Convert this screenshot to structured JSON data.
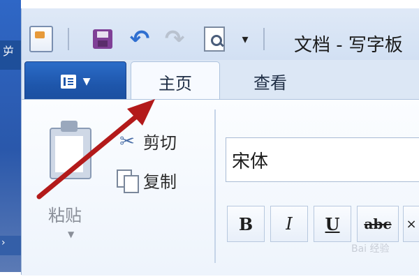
{
  "colors": {
    "ribbon_blue": "#1e56ab",
    "accent_undo": "#2f6fd0",
    "annotation_red": "#b31a1a"
  },
  "window": {
    "title": "文档 - 写字板"
  },
  "quick_access": {
    "icons": [
      "document-icon",
      "save-icon",
      "undo-icon",
      "redo-icon",
      "print-preview-icon",
      "customize-dropdown-icon"
    ],
    "more_glyph": "▾"
  },
  "tabs": {
    "home": "主页",
    "view": "查看"
  },
  "clipboard": {
    "paste_label": "粘贴",
    "cut_label": "剪切",
    "copy_label": "复制"
  },
  "font": {
    "name": "宋体",
    "bold": "B",
    "italic": "I",
    "underline": "U",
    "strikethrough": "abc",
    "more": "×"
  },
  "watermark": {
    "text": "Bai 经验"
  },
  "desktop": {
    "top_letter": "屰",
    "bottom_letter": "›"
  }
}
